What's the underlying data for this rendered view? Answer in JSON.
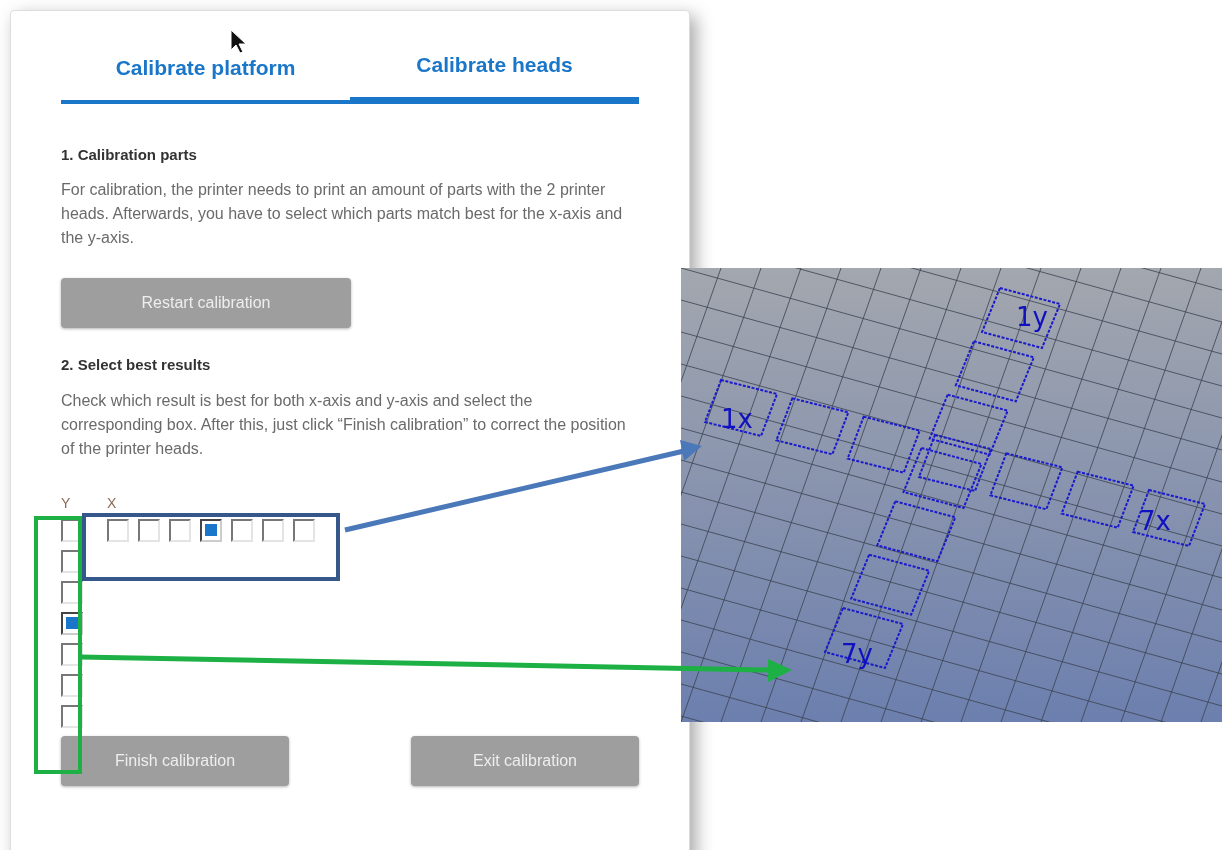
{
  "tabs": [
    {
      "label": "Calibrate platform",
      "selected": false
    },
    {
      "label": "Calibrate heads",
      "selected": true
    }
  ],
  "sections": [
    {
      "heading": "1. Calibration parts",
      "text": "For calibration, the printer needs to print an amount of parts with the 2 printer heads. Afterwards, you have to select which parts match best for the x-axis and the y-axis.",
      "button": "Restart calibration"
    },
    {
      "heading": "2. Select best results",
      "text": "Check which result is best for both x-axis and y-axis and select the corresponding box. After this, just click “Finish calibration” to correct the position of the printer heads."
    }
  ],
  "selection": {
    "y_label": "Y",
    "x_label": "X",
    "y_boxes": [
      {
        "checked": false
      },
      {
        "checked": false
      },
      {
        "checked": false
      },
      {
        "checked": true
      },
      {
        "checked": false
      },
      {
        "checked": false
      },
      {
        "checked": false
      }
    ],
    "x_boxes": [
      {
        "checked": false
      },
      {
        "checked": false
      },
      {
        "checked": false
      },
      {
        "checked": true
      },
      {
        "checked": false
      },
      {
        "checked": false
      },
      {
        "checked": false
      }
    ]
  },
  "footer_buttons": [
    "Finish calibration",
    "Exit calibration"
  ],
  "viewport": {
    "labels": [
      "1x",
      "7x",
      "1y",
      "7y"
    ]
  }
}
